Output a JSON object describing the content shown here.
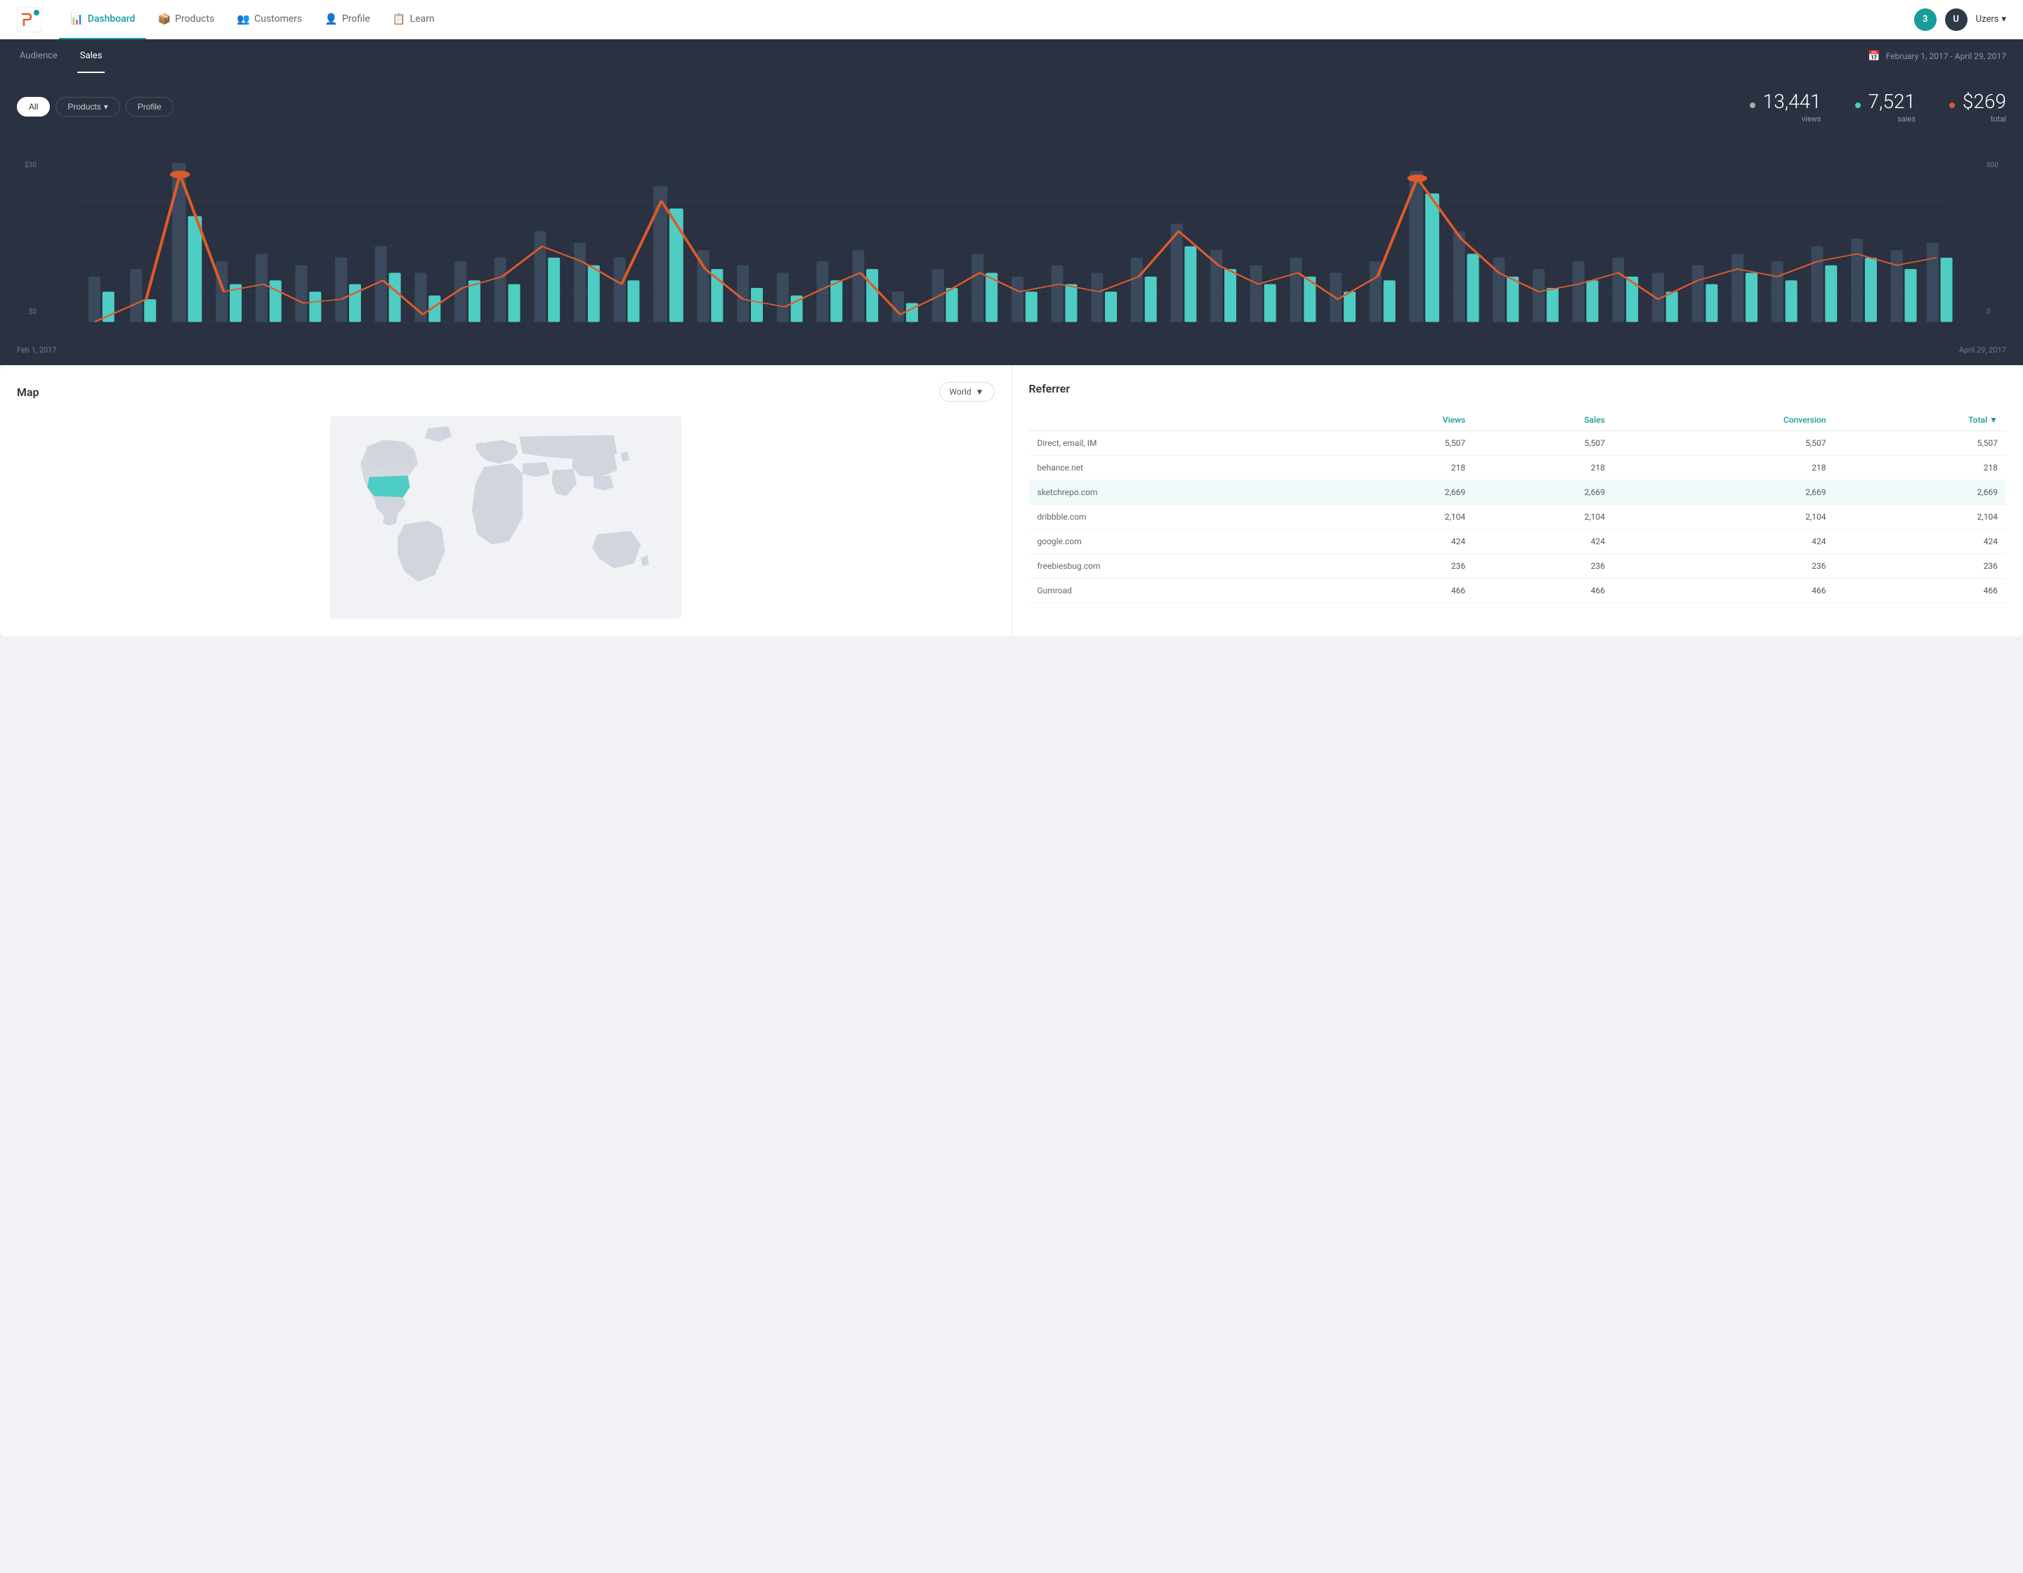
{
  "header": {
    "logo_alt": "Logo",
    "nav": [
      {
        "label": "Dashboard",
        "icon": "chart-icon",
        "active": true
      },
      {
        "label": "Products",
        "icon": "box-icon",
        "active": false
      },
      {
        "label": "Customers",
        "icon": "users-icon",
        "active": false
      },
      {
        "label": "Profile",
        "icon": "user-icon",
        "active": false
      },
      {
        "label": "Learn",
        "icon": "book-icon",
        "active": false
      }
    ],
    "notification_count": "3",
    "user_initial": "U",
    "user_name": "Uzers"
  },
  "sub_nav": {
    "items": [
      {
        "label": "Audience",
        "active": false
      },
      {
        "label": "Sales",
        "active": true
      }
    ],
    "date_range": "February 1, 2017 - April 29, 2017"
  },
  "filters": {
    "all_label": "All",
    "products_label": "Products",
    "profile_label": "Profile"
  },
  "stats": {
    "views_dot_color": "#666",
    "views_value": "13,441",
    "views_label": "views",
    "sales_dot_color": "#4ecdc4",
    "sales_value": "7,521",
    "sales_label": "sales",
    "total_dot_color": "#e05a2b",
    "total_value": "$269",
    "total_label": "total"
  },
  "chart": {
    "x_start": "Feb 1, 2017",
    "x_end": "April 29, 2017",
    "y_left_top": "$30",
    "y_left_bottom": "$0",
    "y_right_top": "800",
    "y_right_bottom": "0"
  },
  "map": {
    "title": "Map",
    "world_label": "World",
    "dropdown_icon": "▼"
  },
  "referrer": {
    "title": "Referrer",
    "columns": [
      {
        "label": "",
        "key": "source"
      },
      {
        "label": "Views",
        "key": "views",
        "teal": true
      },
      {
        "label": "Sales",
        "key": "sales",
        "teal": true
      },
      {
        "label": "Conversion",
        "key": "conversion",
        "teal": true
      },
      {
        "label": "Total ▼",
        "key": "total",
        "teal": true,
        "sortable": true
      }
    ],
    "rows": [
      {
        "source": "Direct, email, IM",
        "views": "5,507",
        "sales": "5,507",
        "conversion": "5,507",
        "total": "5,507",
        "highlight": false
      },
      {
        "source": "behance.net",
        "views": "218",
        "sales": "218",
        "conversion": "218",
        "total": "218",
        "highlight": false
      },
      {
        "source": "sketchrepo.com",
        "views": "2,669",
        "sales": "2,669",
        "conversion": "2,669",
        "total": "2,669",
        "highlight": true
      },
      {
        "source": "dribbble.com",
        "views": "2,104",
        "sales": "2,104",
        "conversion": "2,104",
        "total": "2,104",
        "highlight": false
      },
      {
        "source": "google.com",
        "views": "424",
        "sales": "424",
        "conversion": "424",
        "total": "424",
        "highlight": false
      },
      {
        "source": "freebiesbug.com",
        "views": "236",
        "sales": "236",
        "conversion": "236",
        "total": "236",
        "highlight": false
      },
      {
        "source": "Gumroad",
        "views": "466",
        "sales": "466",
        "conversion": "466",
        "total": "466",
        "highlight": false
      }
    ]
  }
}
